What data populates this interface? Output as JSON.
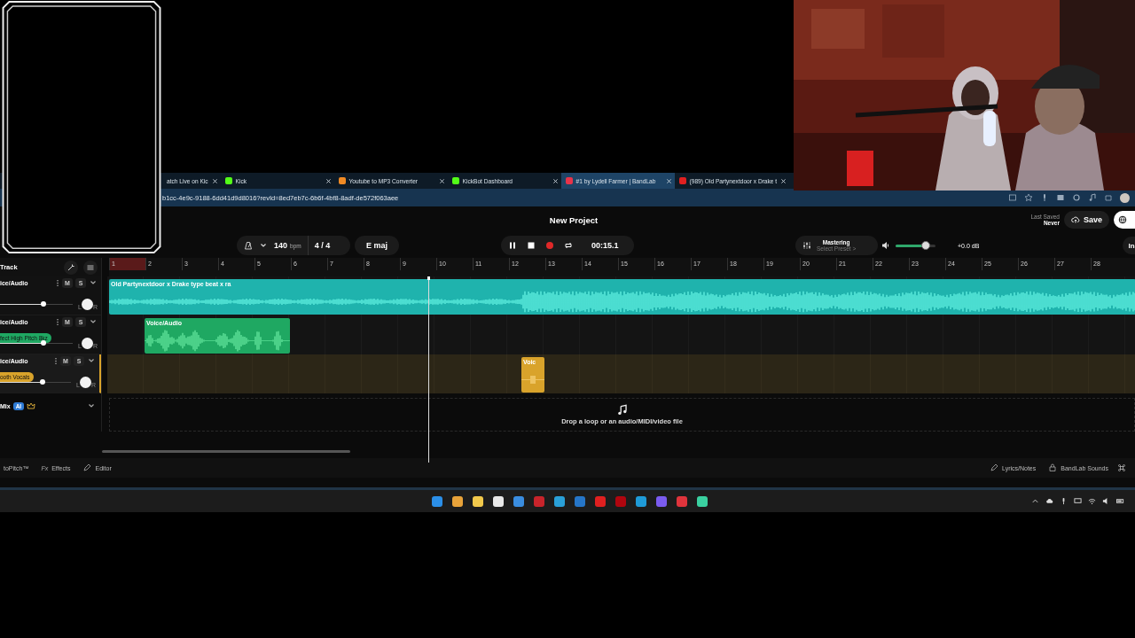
{
  "browser": {
    "tabs": [
      {
        "label": "atch Live on Kic",
        "selected": false
      },
      {
        "label": "Kick",
        "selected": false,
        "color": "#53fc18"
      },
      {
        "label": "Youtube to MP3 Converter",
        "selected": false,
        "color": "#f08a24"
      },
      {
        "label": "KickBot Dashboard",
        "selected": false,
        "color": "#53fc18"
      },
      {
        "label": "#1 by Lydell Farmer | BandLab",
        "selected": true,
        "color": "#e8334a"
      },
      {
        "label": "(989) Old Partynextdoor x Drake t",
        "selected": false,
        "color": "#e02020"
      }
    ],
    "address": {
      "value": "b1cc-4e9c-9188-6dd41d9d8016?revId=8ed7eb7c-6b6f-4bf8-8adf-de572f063aee"
    }
  },
  "header": {
    "title": "New Project",
    "last_saved_label": "Last Saved",
    "last_saved_value": "Never",
    "save_button": "Save",
    "cut_button": "In"
  },
  "transport": {
    "tempo": "140",
    "tempo_unit": "bpm",
    "time_signature": "4 / 4",
    "key": "E maj",
    "playing": true,
    "time": "00:15.1"
  },
  "mastering": {
    "title": "Mastering",
    "subtitle": "Select Preset >"
  },
  "master_volume": {
    "level": 0.75,
    "reading": "+0.0 dB"
  },
  "track_header": {
    "label": "Track"
  },
  "ruler": [
    "1",
    "2",
    "3",
    "4",
    "5",
    "6",
    "7",
    "8",
    "9",
    "10",
    "11",
    "12",
    "13",
    "14",
    "15",
    "16",
    "17",
    "18",
    "19",
    "20",
    "21",
    "22",
    "23",
    "24",
    "25",
    "26",
    "27",
    "28"
  ],
  "tracks": [
    {
      "name": "ice/Audio",
      "mute": "M",
      "solo": "S",
      "level": 0.6,
      "pan_left": "L",
      "pan_right": "R",
      "selected": false,
      "color": "#1fb3ad",
      "clip": {
        "title": "Old Partynextdoor x Drake type beat x ra"
      }
    },
    {
      "name": "ice/Audio",
      "tag": "fect High Pitch 8kz",
      "mute": "M",
      "solo": "S",
      "level": 0.6,
      "pan_left": "L",
      "pan_right": "R",
      "selected": false,
      "color": "#1fa862",
      "clip": {
        "title": "Voice/Audio"
      }
    },
    {
      "name": "ice/Audio",
      "tag": "ooth Vocals",
      "mute": "M",
      "solo": "S",
      "level": 0.6,
      "pan_left": "L",
      "pan_right": "R",
      "selected": true,
      "color": "#d9a32b",
      "clip": {
        "title": "Voic"
      }
    }
  ],
  "mix": {
    "label": "Mix",
    "badge": "AI"
  },
  "drop_zone": "Drop a loop or an audio/MIDI/video file",
  "footer": {
    "left": [
      {
        "kind": "autopitch",
        "label": "toPitch™"
      },
      {
        "kind": "effects",
        "prefix": "Fx",
        "label": "Effects"
      },
      {
        "kind": "editor",
        "label": "Editor"
      }
    ],
    "right": [
      {
        "kind": "lyrics",
        "label": "Lyrics/Notes"
      },
      {
        "kind": "sounds",
        "label": "BandLab Sounds"
      }
    ]
  }
}
